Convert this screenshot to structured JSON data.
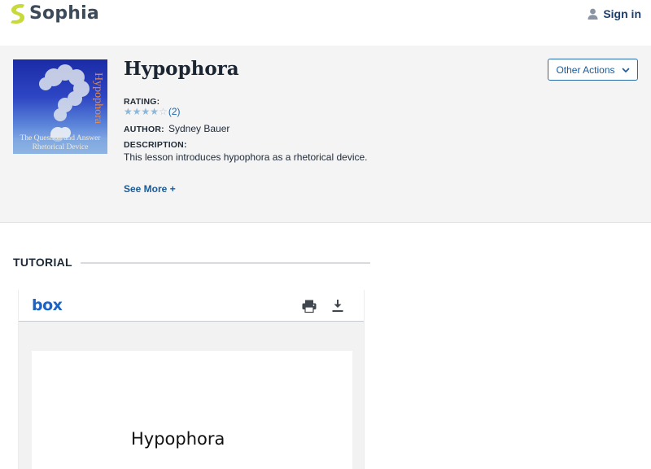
{
  "header": {
    "brand": "Sophia",
    "signin_label": "Sign in"
  },
  "lesson": {
    "thumbnail": {
      "side_text": "Hypophora",
      "caption_line1": "The Question and Answer",
      "caption_line2": "Rhetorical Device"
    },
    "title": "Hypophora",
    "rating_label": "RATING:",
    "rating_value": 4,
    "rating_max": 5,
    "rating_count": "(2)",
    "author_label": "AUTHOR:",
    "author_name": "Sydney Bauer",
    "description_label": "DESCRIPTION:",
    "description": "This lesson introduces hypophora as a rhetorical device.",
    "see_more_label": "See More +",
    "other_actions_label": "Other Actions"
  },
  "tutorial": {
    "heading": "TUTORIAL",
    "viewer": {
      "brand": "box",
      "document_title": "Hypophora"
    }
  },
  "icons": {
    "brand_mark": "sophia-logo-icon",
    "user": "user-icon",
    "dropdown": "chevron-down-icon",
    "print": "print-icon",
    "download": "download-icon"
  },
  "colors": {
    "brand_green": "#c8d93a",
    "link_blue": "#1b5a98",
    "box_blue": "#1b63c6",
    "panel_bg": "#f4f4f4"
  }
}
